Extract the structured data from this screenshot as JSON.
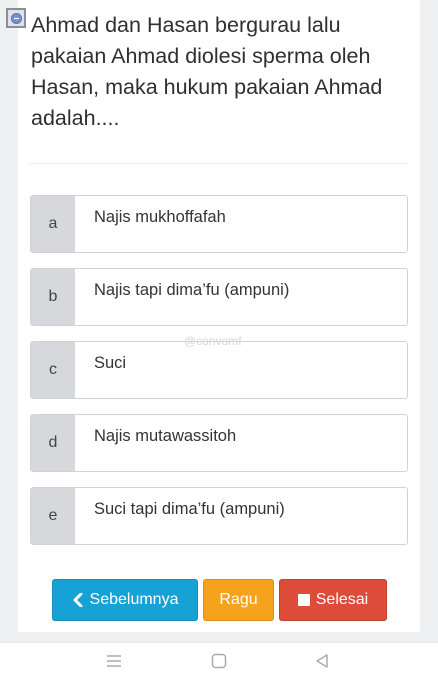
{
  "question": {
    "text": "Ahmad dan Hasan bergurau lalu pakaian Ahmad diolesi sperma oleh Hasan, maka hukum pakaian Ahmad adalah...."
  },
  "options": [
    {
      "letter": "a",
      "text": "Najis mukhoffafah"
    },
    {
      "letter": "b",
      "text": "Najis tapi dima’fu (ampuni)"
    },
    {
      "letter": "c",
      "text": "Suci"
    },
    {
      "letter": "d",
      "text": "Najis mutawassitoh"
    },
    {
      "letter": "e",
      "text": "Suci tapi dima’fu (ampuni)"
    }
  ],
  "watermark": "@convomf",
  "buttons": {
    "prev_label": "Sebelumnya",
    "ragu_label": "Ragu",
    "done_label": "Selesai"
  },
  "colors": {
    "prev": "#17a2d6",
    "ragu": "#f6a21d",
    "done": "#dd4b39"
  },
  "icons": {
    "flag": "question-flag-icon",
    "prev": "chevron-left-icon",
    "done": "stop-square-icon",
    "nav_menu": "menu-icon",
    "nav_home": "home-square-icon",
    "nav_back": "back-triangle-icon"
  }
}
